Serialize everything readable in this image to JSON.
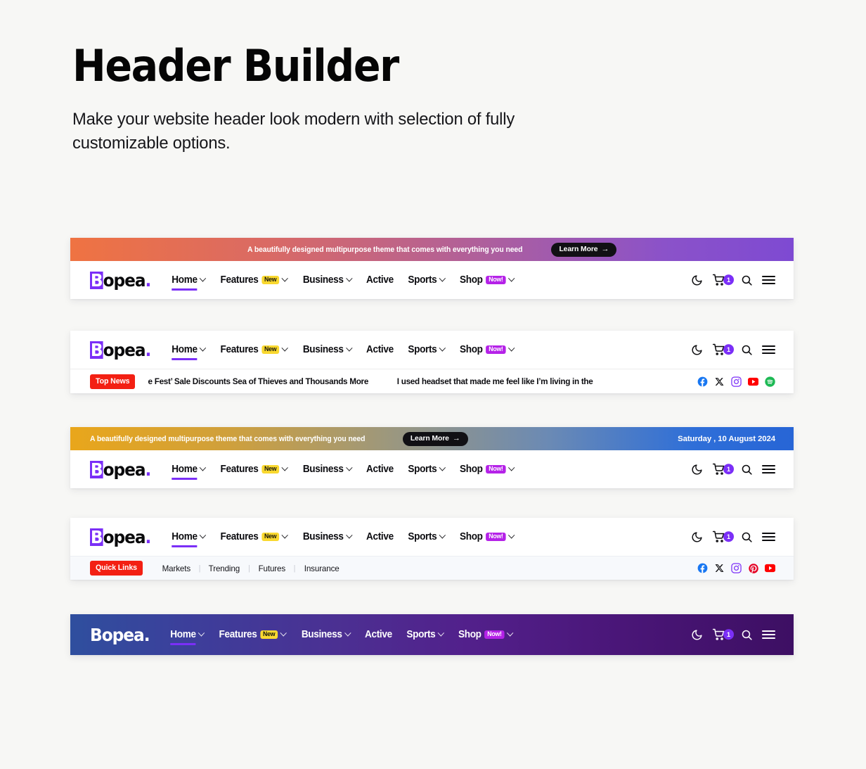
{
  "intro": {
    "title": "Header Builder",
    "subtitle": "Make your website header look modern with selection of fully customizable options."
  },
  "brand": {
    "first_letter": "B",
    "rest": "opea",
    "dot": ".",
    "accent_color": "#7b2ff7"
  },
  "nav": {
    "items": [
      {
        "label": "Home",
        "caret": true,
        "badge": null,
        "active": true
      },
      {
        "label": "Features",
        "caret": true,
        "badge": "New",
        "badge_type": "new",
        "active": false
      },
      {
        "label": "Business",
        "caret": true,
        "badge": null,
        "active": false
      },
      {
        "label": "Active",
        "caret": false,
        "badge": null,
        "active": false
      },
      {
        "label": "Sports",
        "caret": true,
        "badge": null,
        "active": false
      },
      {
        "label": "Shop",
        "caret": true,
        "badge": "Now!",
        "badge_type": "now",
        "active": false
      }
    ],
    "icons": {
      "theme": "moon-icon",
      "cart": "cart-icon",
      "cart_count": "1",
      "search": "search-icon",
      "menu": "hamburger-icon"
    }
  },
  "promo": {
    "text": "A beautifully designed multipurpose theme that comes with everything you need",
    "button_label": "Learn More",
    "button_arrow": "→",
    "date": "Saturday , 10 August 2024",
    "gradient_orange_purple": [
      "#ef7342",
      "#7e4ad2"
    ],
    "gradient_gold_blue": [
      "#e9a61b",
      "#2765d6"
    ]
  },
  "ticker": {
    "tag": "Top News",
    "tag_color": "#f32013",
    "items": [
      "e Fest’ Sale Discounts Sea of Thieves and Thousands More",
      "I used headset that made me feel like I’m living in the"
    ],
    "socials": [
      "facebook",
      "x",
      "instagram",
      "youtube",
      "spotify"
    ]
  },
  "quick_links": {
    "tag": "Quick Links",
    "tag_color": "#f32013",
    "items": [
      "Markets",
      "Trending",
      "Futures",
      "Insurance"
    ],
    "separator": "|",
    "socials": [
      "facebook",
      "x",
      "instagram",
      "pinterest",
      "youtube"
    ]
  },
  "headers": [
    {
      "id": "header-1",
      "variant": "promo-gradient-orange"
    },
    {
      "id": "header-2",
      "variant": "news-ticker"
    },
    {
      "id": "header-3",
      "variant": "promo-gradient-gold-date"
    },
    {
      "id": "header-4",
      "variant": "quick-links"
    },
    {
      "id": "header-5",
      "variant": "dark-gradient"
    }
  ]
}
